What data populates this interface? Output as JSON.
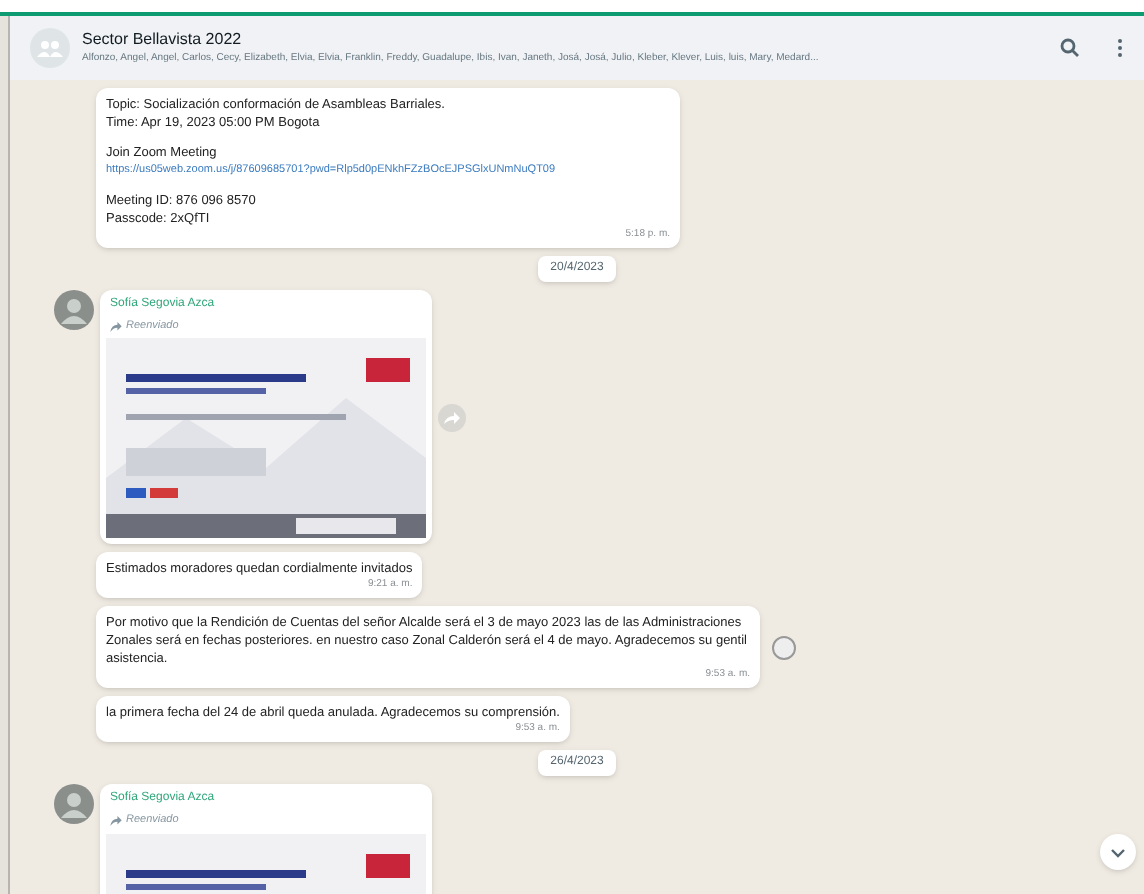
{
  "header": {
    "title": "Sector Bellavista 2022",
    "members": "Alfonzo, Angel, Angel, Carlos, Cecy, Elizabeth, Elvia, Elvia, Franklin, Freddy, Guadalupe, Ibis, Ivan, Janeth, Josá, Josá, Julio, Kleber, Klever, Luis, luis, Mary, Medard..."
  },
  "messages": [
    {
      "kind": "text",
      "blocks": [
        [
          {
            "kind": "line",
            "text": "Topic: Socialización conformación de Asambleas Barriales."
          },
          {
            "kind": "line",
            "text": "Time: Apr 19, 2023 05:00 PM Bogota"
          }
        ],
        [
          {
            "kind": "line",
            "text": "Join Zoom Meeting"
          },
          {
            "kind": "link",
            "text": "https://us05web.zoom.us/j/87609685701?pwd=Rlp5d0pENkhFZzBOcEJPSGlxUNmNuQT09"
          }
        ],
        [
          {
            "kind": "line",
            "text": "Meeting ID: 876 096 8570"
          },
          {
            "kind": "line",
            "text": "Passcode: 2xQfTI"
          }
        ]
      ],
      "time": "5:18 p. m.",
      "side_button": false
    },
    {
      "kind": "date",
      "text": "20/4/2023"
    },
    {
      "kind": "media",
      "sender": "Sofía Segovia Azca",
      "forwarded": "Reenviado",
      "side_button": true
    },
    {
      "kind": "text",
      "blocks": [
        [
          {
            "kind": "line",
            "text": "Estimados moradores quedan cordialmente invitados"
          }
        ]
      ],
      "time": "9:21 a. m.",
      "side_button": false
    },
    {
      "kind": "text",
      "blocks": [
        [
          {
            "kind": "line",
            "text": "Por motivo que la  Rendición de Cuentas del señor Alcalde  será el 3 de mayo 2023 las de las Administraciones Zonales será en fechas posteriores. en nuestro caso Zonal Calderón será el 4 de mayo. Agradecemos su gentil asistencia."
          }
        ]
      ],
      "time": "9:53 a. m.",
      "side_button": true
    },
    {
      "kind": "text",
      "blocks": [
        [
          {
            "kind": "line",
            "text": "la primera fecha del 24 de abril queda anulada. Agradecemos su comprensión."
          }
        ]
      ],
      "time": "9:53 a. m.",
      "side_button": false
    },
    {
      "kind": "date",
      "text": "26/4/2023"
    },
    {
      "kind": "media",
      "sender": "Sofía Segovia Azca",
      "forwarded": "Reenviado",
      "side_button": false
    }
  ]
}
